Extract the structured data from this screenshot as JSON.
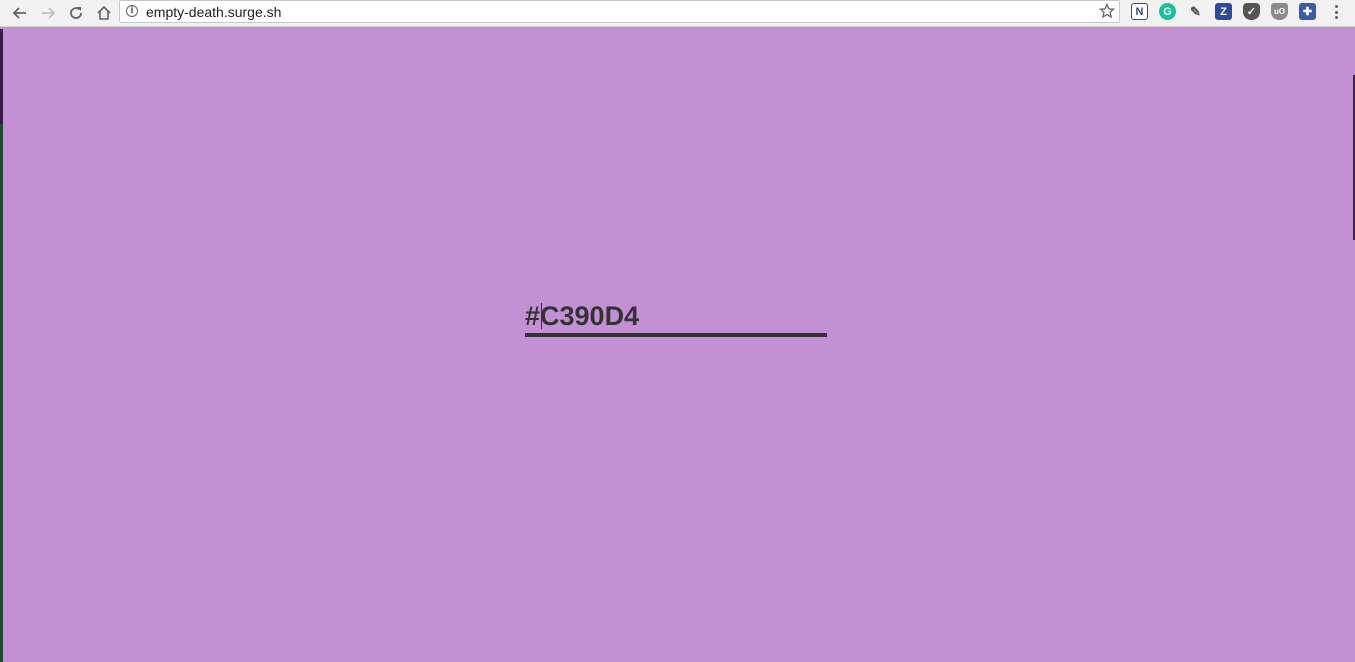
{
  "browser": {
    "url": "empty-death.surge.sh",
    "info_symbol": "i",
    "extensions": [
      {
        "name": "notion-extension",
        "glyph": "N"
      },
      {
        "name": "grammarly-extension",
        "glyph": "G"
      },
      {
        "name": "evernote-extension",
        "glyph": "✎"
      },
      {
        "name": "zotero-extension",
        "glyph": "Z"
      },
      {
        "name": "pocket-extension",
        "glyph": "✓"
      },
      {
        "name": "ublock-extension",
        "glyph": "uO"
      },
      {
        "name": "puzzle-extension",
        "glyph": "✚"
      }
    ]
  },
  "colors": {
    "page_background": "#c390d4",
    "text": "#333333"
  },
  "page": {
    "hex_value": "#C390D4"
  }
}
